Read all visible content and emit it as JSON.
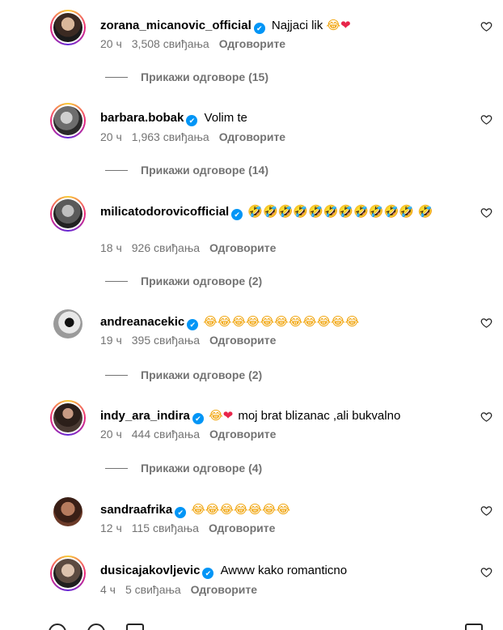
{
  "comments": [
    {
      "username": "zorana_micanovic_official",
      "text": "Najjaci lik",
      "emojis": "😂",
      "heart": "❤",
      "time": "20 ч",
      "likes": "3,508 свиђања",
      "reply": "Одговорите",
      "view_replies": "Прикажи одговоре (15)"
    },
    {
      "username": "barbara.bobak",
      "text": "Volim te",
      "emojis": "",
      "heart": "",
      "time": "20 ч",
      "likes": "1,963 свиђања",
      "reply": "Одговорите",
      "view_replies": "Прикажи одговоре (14)"
    },
    {
      "username": "milicatodorovicofficial",
      "text": "",
      "emojis": "🤣🤣🤣🤣🤣🤣🤣🤣🤣🤣🤣 🤣",
      "heart": "",
      "time": "18 ч",
      "likes": "926 свиђања",
      "reply": "Одговорите",
      "view_replies": "Прикажи одговоре (2)"
    },
    {
      "username": "andreanacekic",
      "text": "",
      "emojis": "😂😂😂😂😂😂😂😂😂😂😂",
      "heart": "",
      "time": "19 ч",
      "likes": "395 свиђања",
      "reply": "Одговорите",
      "view_replies": "Прикажи одговоре (2)"
    },
    {
      "username": "indy_ara_indira",
      "text": "moj brat blizanac ,ali bukvalno",
      "emojis": "😂",
      "heart": "❤",
      "time": "20 ч",
      "likes": "444 свиђања",
      "reply": "Одговорите",
      "view_replies": "Прикажи одговоре (4)"
    },
    {
      "username": "sandraafrika",
      "text": "",
      "emojis": "😂😂😂😂😂😂😂",
      "heart": "",
      "time": "12 ч",
      "likes": "115 свиђања",
      "reply": "Одговорите"
    },
    {
      "username": "dusicajakovljevic",
      "text": "Awww kako romanticno",
      "emojis": "",
      "heart": "",
      "time": "4 ч",
      "likes": "5 свиђања",
      "reply": "Одговорите"
    }
  ],
  "icons": {
    "verified": "✔",
    "like": "heart-outline-icon"
  },
  "colors": {
    "verified": "#0095f6",
    "meta": "#737373"
  }
}
